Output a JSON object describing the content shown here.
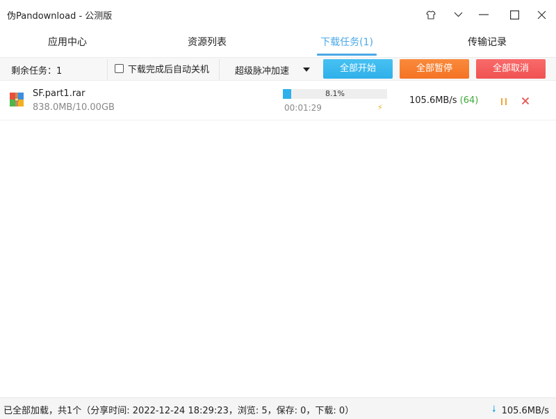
{
  "window": {
    "title": "伪Pandownload - 公测版"
  },
  "titlebar_icons": [
    "shirt-icon",
    "chevron-down-icon",
    "minimize-icon",
    "maximize-icon",
    "close-icon"
  ],
  "tabs": [
    {
      "label": "应用中心"
    },
    {
      "label": "资源列表"
    },
    {
      "label": "下载任务(1)",
      "active": true
    },
    {
      "label": "传输记录"
    }
  ],
  "toolbar": {
    "remaining": "剩余任务：1",
    "auto_shutdown": "下载完成后自动关机",
    "accel_mode": "超级脉冲加速",
    "start_all": "全部开始",
    "pause_all": "全部暂停",
    "cancel_all": "全部取消"
  },
  "downloads": [
    {
      "name": "SF.part1.rar",
      "size": "838.0MB/10.00GB",
      "progress_text": "8.1%",
      "progress": 0.081,
      "elapsed": "00:01:29",
      "speed": "105.6MB/s",
      "connections": "(64)"
    }
  ],
  "status": {
    "text": "已全部加载，共1个（分享时间: 2022-12-24 18:29:23，浏览: 5，保存: 0，下载: 0）",
    "speed": "105.6MB/s"
  },
  "colors": {
    "accent": "#4aa8e8",
    "start": "#2fb0ea",
    "pause": "#f57324",
    "cancel": "#f05252",
    "connections": "#3fa93a"
  }
}
